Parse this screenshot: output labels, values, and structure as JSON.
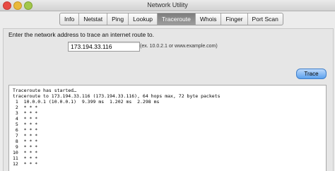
{
  "window": {
    "title": "Network Utility"
  },
  "tabs": [
    {
      "label": "Info"
    },
    {
      "label": "Netstat"
    },
    {
      "label": "Ping"
    },
    {
      "label": "Lookup"
    },
    {
      "label": "Traceroute",
      "selected": true
    },
    {
      "label": "Whois"
    },
    {
      "label": "Finger"
    },
    {
      "label": "Port Scan"
    }
  ],
  "form": {
    "prompt": "Enter the network address to trace an internet route to.",
    "address_value": "173.194.33.116",
    "hint": "(ex. 10.0.2.1 or www.example.com)",
    "trace_label": "Trace"
  },
  "output": {
    "lines": [
      "Traceroute has started…",
      "",
      "traceroute to 173.194.33.116 (173.194.33.116), 64 hops max, 72 byte packets",
      " 1  10.0.0.1 (10.0.0.1)  9.399 ms  1.202 ms  2.298 ms",
      " 2  * * *",
      " 3  * * *",
      " 4  * * *",
      " 5  * * *",
      " 6  * * *",
      " 7  * * *",
      " 8  * * *",
      " 9  * * *",
      "10  * * *",
      "11  * * *",
      "12  * * *"
    ]
  }
}
